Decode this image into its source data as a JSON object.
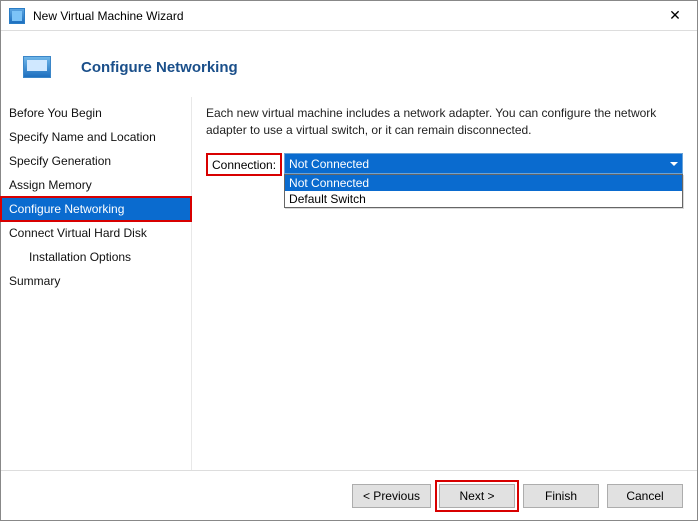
{
  "window": {
    "title": "New Virtual Machine Wizard",
    "close_glyph": "✕"
  },
  "header": {
    "title": "Configure Networking"
  },
  "sidebar": {
    "steps": [
      {
        "label": "Before You Begin"
      },
      {
        "label": "Specify Name and Location"
      },
      {
        "label": "Specify Generation"
      },
      {
        "label": "Assign Memory"
      },
      {
        "label": "Configure Networking"
      },
      {
        "label": "Connect Virtual Hard Disk"
      },
      {
        "label": "Installation Options"
      },
      {
        "label": "Summary"
      }
    ]
  },
  "main": {
    "description": "Each new virtual machine includes a network adapter. You can configure the network adapter to use a virtual switch, or it can remain disconnected.",
    "connection_label": "Connection:",
    "connection_selected": "Not Connected",
    "connection_options": [
      "Not Connected",
      "Default Switch"
    ]
  },
  "footer": {
    "previous": "< Previous",
    "next": "Next >",
    "finish": "Finish",
    "cancel": "Cancel"
  }
}
